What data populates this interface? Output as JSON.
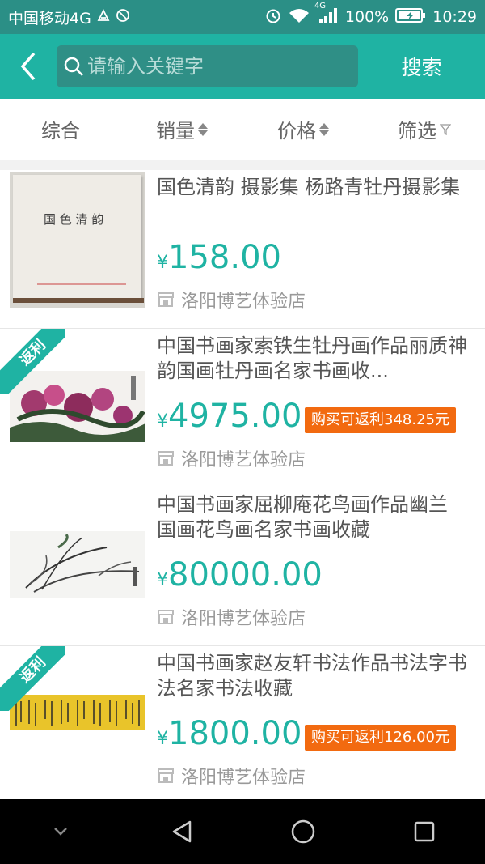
{
  "status_bar": {
    "carrier": "中国移动4G",
    "network": "4G",
    "battery": "100%",
    "time": "10:29"
  },
  "header": {
    "back_icon": "chevron-left-icon",
    "search_placeholder": "请输入关键字",
    "search_button": "搜索"
  },
  "filters": {
    "general": "综合",
    "sales": "销量",
    "price": "价格",
    "filter": "筛选"
  },
  "products": [
    {
      "title": "国色清韵 摄影集 杨路青牡丹摄影集",
      "currency": "¥",
      "price": "158.00",
      "store": "洛阳博艺体验店",
      "image_text": "国 色 清 韵"
    },
    {
      "badge": "返利",
      "title": "中国书画家索铁生牡丹画作品丽质神韵国画牡丹画名家书画收...",
      "currency": "¥",
      "price": "4975.00",
      "rebate": "购买可返利348.25元",
      "store": "洛阳博艺体验店"
    },
    {
      "title": "中国书画家屈柳庵花鸟画作品幽兰 国画花鸟画名家书画收藏",
      "currency": "¥",
      "price": "80000.00",
      "store": "洛阳博艺体验店"
    },
    {
      "badge": "返利",
      "title": "中国书画家赵友轩书法作品书法字书法名家书法收藏",
      "currency": "¥",
      "price": "1800.00",
      "rebate": "购买可返利126.00元",
      "store": "洛阳博艺体验店"
    }
  ],
  "colors": {
    "accent": "#1fb3a3",
    "rebate": "#f26a10"
  }
}
